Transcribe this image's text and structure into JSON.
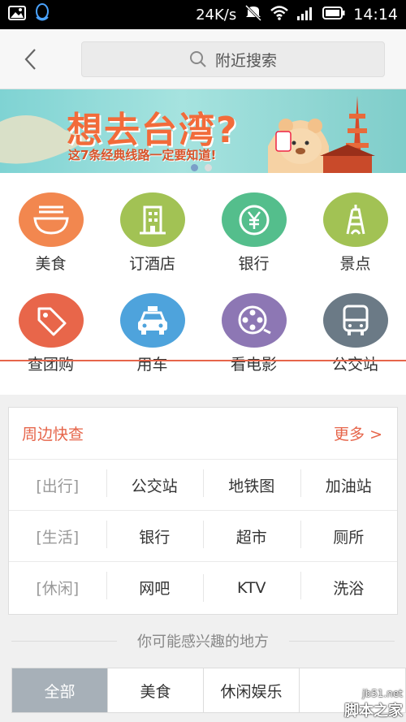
{
  "status_bar": {
    "speed": "24K/s",
    "time": "14:14"
  },
  "search": {
    "placeholder": "附近搜索"
  },
  "banner": {
    "title": "想去台湾?",
    "subtitle": "这7条经典线路一定要知道!"
  },
  "categories": [
    {
      "label": "美食",
      "icon": "bowl-icon",
      "color": "#f2874f"
    },
    {
      "label": "订酒店",
      "icon": "building-icon",
      "color": "#a2c254"
    },
    {
      "label": "银行",
      "icon": "yen-coin-icon",
      "color": "#54be8c"
    },
    {
      "label": "景点",
      "icon": "tower-icon",
      "color": "#a2c254"
    },
    {
      "label": "查团购",
      "icon": "tag-icon",
      "color": "#e8664a"
    },
    {
      "label": "用车",
      "icon": "taxi-icon",
      "color": "#4ea3dc"
    },
    {
      "label": "看电影",
      "icon": "film-reel-icon",
      "color": "#8d77b4"
    },
    {
      "label": "公交站",
      "icon": "bus-icon",
      "color": "#6b7a86"
    }
  ],
  "quick": {
    "title": "周边快查",
    "more": "更多 >",
    "rows": [
      {
        "category": "[出行]",
        "items": [
          "公交站",
          "地铁图",
          "加油站"
        ]
      },
      {
        "category": "[生活]",
        "items": [
          "银行",
          "超市",
          "厕所"
        ]
      },
      {
        "category": "[休闲]",
        "items": [
          "网吧",
          "KTV",
          "洗浴"
        ]
      }
    ]
  },
  "interest": {
    "title": "你可能感兴趣的地方"
  },
  "tabs": [
    "全部",
    "美食",
    "休闲娱乐"
  ],
  "watermark": {
    "site": "jb51.net",
    "brand": "脚本之家"
  }
}
